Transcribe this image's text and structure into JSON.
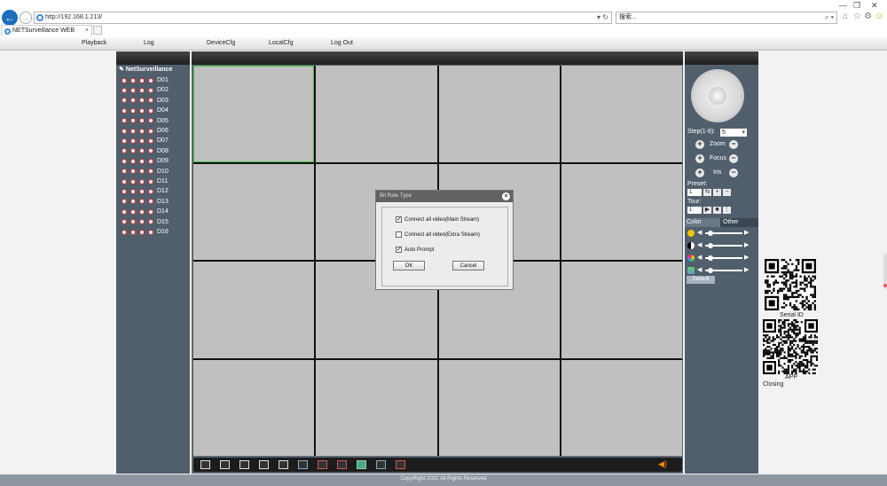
{
  "browser": {
    "url": "http://192.168.1.213/",
    "search_placeholder": "搜索...",
    "tab_title": "NETSurveillance WEB",
    "tab_close": "×",
    "back_icon": "arrow-left-icon",
    "forward_icon": "arrow-right-icon",
    "win_min": "—",
    "win_max": "❐",
    "win_close": "✕",
    "address_ctl": "▾ ↻",
    "search_ctl": "⌕ ▾",
    "home_icon": "⌂",
    "star_icon": "☆",
    "gear_icon": "⚙",
    "smiley_icon": "☺"
  },
  "menu": {
    "items": [
      "Playback",
      "Log",
      "DeviceCfg",
      "LocalCfg",
      "Log Out"
    ]
  },
  "cameras": {
    "header": "NetSurveillance",
    "channels": [
      "D01",
      "D02",
      "D03",
      "D04",
      "D05",
      "D06",
      "D07",
      "D08",
      "D09",
      "D10",
      "D11",
      "D12",
      "D13",
      "D14",
      "D15",
      "D16"
    ]
  },
  "ptz": {
    "step_label": "Step(1-8):",
    "step_value": "5",
    "zoom_label": "Zoom",
    "focus_label": "Focus",
    "iris_label": "Iris",
    "preset_label": "Preset:",
    "preset_value": "1",
    "tour_label": "Tour:",
    "tour_value": "1",
    "tab_color": "Color",
    "tab_other": "Other",
    "default_label": "Default",
    "plus": "+",
    "minus": "−"
  },
  "dialog": {
    "title": "Bit Rate Type",
    "close": "×",
    "options": [
      {
        "label": "Connect all video(Main Stream)",
        "checked": true
      },
      {
        "label": "Connect all video(Extra Stream)",
        "checked": false
      },
      {
        "label": "Auto Prompt",
        "checked": true
      }
    ],
    "ok_label": "OK",
    "cancel_label": "Cancel"
  },
  "qr": {
    "serial_label": "Serial ID",
    "app_label": "APP",
    "closing_label": "Closing"
  },
  "footer": {
    "text": "CopyRight 2021 All Rights Reserved"
  },
  "colors": {
    "panel": "#515f6d",
    "video_cell": "#c0c0c0",
    "selected_cell_border": "#3cc43c",
    "accent_blue": "#1b6dbc"
  }
}
